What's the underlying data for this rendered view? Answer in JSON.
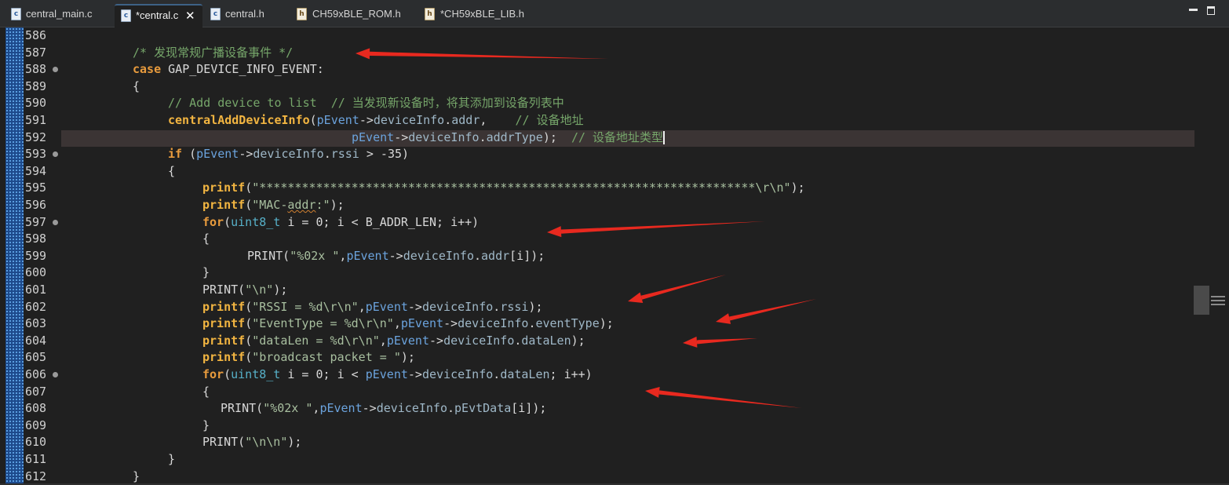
{
  "tabs": [
    {
      "icon": "c",
      "label": "central_main.c",
      "active": false
    },
    {
      "icon": "c",
      "label": "*central.c",
      "active": true,
      "close_glyph": "✕"
    },
    {
      "icon": "c",
      "label": "central.h",
      "active": false
    },
    {
      "icon": "h",
      "label": "CH59xBLE_ROM.h",
      "active": false
    },
    {
      "icon": "h",
      "label": "*CH59xBLE_LIB.h",
      "active": false
    }
  ],
  "window_controls": {
    "minimize": "minimize",
    "maximize": "maximize"
  },
  "editor": {
    "line_numbers": [
      "586",
      "587",
      "588",
      "589",
      "590",
      "591",
      "592",
      "593",
      "594",
      "595",
      "596",
      "597",
      "598",
      "599",
      "600",
      "601",
      "602",
      "603",
      "604",
      "605",
      "606",
      "607",
      "608",
      "609",
      "610",
      "611",
      "612"
    ],
    "fold_markers_on": [
      "588",
      "593",
      "597",
      "606"
    ],
    "current_line": "592",
    "lines": [
      {
        "ln": "586",
        "segments": []
      },
      {
        "ln": "587",
        "segments": [
          [
            "comment",
            "/* 发现常规广播设备事件 */"
          ]
        ]
      },
      {
        "ln": "588",
        "segments": [
          [
            "kw",
            "case"
          ],
          [
            "plain",
            " GAP_DEVICE_INFO_EVENT:"
          ]
        ]
      },
      {
        "ln": "589",
        "segments": [
          [
            "plain",
            "{"
          ]
        ]
      },
      {
        "ln": "590",
        "segments": [
          [
            "comment",
            "// Add device to list  // 当发现新设备时，将其添加到设备列表中"
          ]
        ]
      },
      {
        "ln": "591",
        "segments": [
          [
            "fn",
            "centralAddDeviceInfo"
          ],
          [
            "plain",
            "("
          ],
          [
            "var",
            "pEvent"
          ],
          [
            "plain",
            "->"
          ],
          [
            "field",
            "deviceInfo"
          ],
          [
            "plain",
            "."
          ],
          [
            "field",
            "addr"
          ],
          [
            "plain",
            ",    "
          ],
          [
            "comment",
            "// 设备地址"
          ]
        ]
      },
      {
        "ln": "592",
        "segments": [
          [
            "var",
            "pEvent"
          ],
          [
            "plain",
            "->"
          ],
          [
            "field",
            "deviceInfo"
          ],
          [
            "plain",
            "."
          ],
          [
            "field",
            "addrType"
          ],
          [
            "plain",
            ");  "
          ],
          [
            "comment",
            "// 设备地址类型"
          ]
        ]
      },
      {
        "ln": "593",
        "segments": [
          [
            "kw",
            "if"
          ],
          [
            "plain",
            " ("
          ],
          [
            "var",
            "pEvent"
          ],
          [
            "plain",
            "->"
          ],
          [
            "field",
            "deviceInfo"
          ],
          [
            "plain",
            "."
          ],
          [
            "field",
            "rssi"
          ],
          [
            "plain",
            " > -35)"
          ]
        ]
      },
      {
        "ln": "594",
        "segments": [
          [
            "plain",
            "{"
          ]
        ]
      },
      {
        "ln": "595",
        "segments": [
          [
            "fn",
            "printf"
          ],
          [
            "plain",
            "("
          ],
          [
            "str",
            "\"**********************************************************************\\r\\n\""
          ],
          [
            "plain",
            ");"
          ]
        ]
      },
      {
        "ln": "596",
        "segments": [
          [
            "fn",
            "printf"
          ],
          [
            "plain",
            "("
          ],
          [
            "str",
            "\"MAC-"
          ],
          [
            "str squiggle",
            "addr"
          ],
          [
            "str",
            ":\""
          ],
          [
            "plain",
            ");"
          ]
        ]
      },
      {
        "ln": "597",
        "segments": [
          [
            "kw",
            "for"
          ],
          [
            "plain",
            "("
          ],
          [
            "type",
            "uint8_t"
          ],
          [
            "plain",
            " i = 0; i < B_ADDR_LEN; i++)"
          ]
        ]
      },
      {
        "ln": "598",
        "segments": [
          [
            "plain",
            "{"
          ]
        ]
      },
      {
        "ln": "599",
        "segments": [
          [
            "plain",
            "PRINT("
          ],
          [
            "str",
            "\"%02x \""
          ],
          [
            "plain",
            ","
          ],
          [
            "var",
            "pEvent"
          ],
          [
            "plain",
            "->"
          ],
          [
            "field",
            "deviceInfo"
          ],
          [
            "plain",
            "."
          ],
          [
            "field",
            "addr"
          ],
          [
            "plain",
            "[i]);"
          ]
        ]
      },
      {
        "ln": "600",
        "segments": [
          [
            "plain",
            "}"
          ]
        ]
      },
      {
        "ln": "601",
        "segments": [
          [
            "plain",
            "PRINT("
          ],
          [
            "str",
            "\"\\n\""
          ],
          [
            "plain",
            ");"
          ]
        ]
      },
      {
        "ln": "602",
        "segments": [
          [
            "fn",
            "printf"
          ],
          [
            "plain",
            "("
          ],
          [
            "str",
            "\"RSSI = %d\\r\\n\""
          ],
          [
            "plain",
            ","
          ],
          [
            "var",
            "pEvent"
          ],
          [
            "plain",
            "->"
          ],
          [
            "field",
            "deviceInfo"
          ],
          [
            "plain",
            "."
          ],
          [
            "field",
            "rssi"
          ],
          [
            "plain",
            ");"
          ]
        ]
      },
      {
        "ln": "603",
        "segments": [
          [
            "fn",
            "printf"
          ],
          [
            "plain",
            "("
          ],
          [
            "str",
            "\"EventType = %d\\r\\n\""
          ],
          [
            "plain",
            ","
          ],
          [
            "var",
            "pEvent"
          ],
          [
            "plain",
            "->"
          ],
          [
            "field",
            "deviceInfo"
          ],
          [
            "plain",
            "."
          ],
          [
            "field",
            "eventType"
          ],
          [
            "plain",
            ");"
          ]
        ]
      },
      {
        "ln": "604",
        "segments": [
          [
            "fn",
            "printf"
          ],
          [
            "plain",
            "("
          ],
          [
            "str",
            "\"dataLen = %d\\r\\n\""
          ],
          [
            "plain",
            ","
          ],
          [
            "var",
            "pEvent"
          ],
          [
            "plain",
            "->"
          ],
          [
            "field",
            "deviceInfo"
          ],
          [
            "plain",
            "."
          ],
          [
            "field",
            "dataLen"
          ],
          [
            "plain",
            ");"
          ]
        ]
      },
      {
        "ln": "605",
        "segments": [
          [
            "fn",
            "printf"
          ],
          [
            "plain",
            "("
          ],
          [
            "str",
            "\"broadcast packet = \""
          ],
          [
            "plain",
            ");"
          ]
        ]
      },
      {
        "ln": "606",
        "segments": [
          [
            "kw",
            "for"
          ],
          [
            "plain",
            "("
          ],
          [
            "type",
            "uint8_t"
          ],
          [
            "plain",
            " i = 0; i < "
          ],
          [
            "var",
            "pEvent"
          ],
          [
            "plain",
            "->"
          ],
          [
            "field",
            "deviceInfo"
          ],
          [
            "plain",
            "."
          ],
          [
            "field",
            "dataLen"
          ],
          [
            "plain",
            "; i++)"
          ]
        ]
      },
      {
        "ln": "607",
        "segments": [
          [
            "plain",
            "{"
          ]
        ]
      },
      {
        "ln": "608",
        "segments": [
          [
            "plain",
            "PRINT("
          ],
          [
            "str",
            "\"%02x \""
          ],
          [
            "plain",
            ","
          ],
          [
            "var",
            "pEvent"
          ],
          [
            "plain",
            "->"
          ],
          [
            "field",
            "deviceInfo"
          ],
          [
            "plain",
            "."
          ],
          [
            "field",
            "pEvtData"
          ],
          [
            "plain",
            "[i]);"
          ]
        ]
      },
      {
        "ln": "609",
        "segments": [
          [
            "plain",
            "}"
          ]
        ]
      },
      {
        "ln": "610",
        "segments": [
          [
            "plain",
            "PRINT("
          ],
          [
            "str",
            "\"\\n\\n\""
          ],
          [
            "plain",
            ");"
          ]
        ]
      },
      {
        "ln": "611",
        "segments": [
          [
            "plain",
            "}"
          ]
        ]
      },
      {
        "ln": "612",
        "segments": [
          [
            "plain",
            "}"
          ]
        ]
      }
    ]
  },
  "colors": {
    "arrow": "#e8291f",
    "editor_bg": "#202020",
    "current_line_bg": "#3b3434",
    "keyword": "#e89b3d",
    "comment": "#76a66a"
  }
}
